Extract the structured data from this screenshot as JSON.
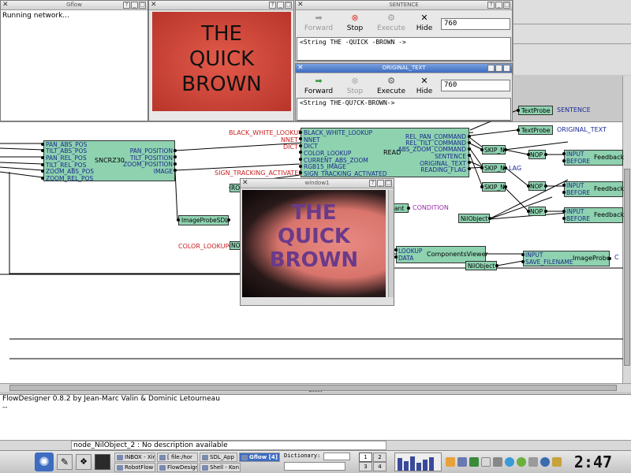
{
  "gflow_window": {
    "title": "Gflow",
    "log_text": "Running network..."
  },
  "camera_window": {
    "image_text": [
      "THE",
      "QUICK",
      "BROWN"
    ]
  },
  "sentence_window": {
    "title": "SENTENCE",
    "buttons": {
      "forward": "Forward",
      "stop": "Stop",
      "execute": "Execute",
      "hide": "Hide"
    },
    "value": "760",
    "output": "<String THE -QUICK -BROWN ->"
  },
  "original_text_window": {
    "title": "ORIGINAL_TEXT",
    "buttons": {
      "forward": "Forward",
      "stop": "Stop",
      "execute": "Execute",
      "hide": "Hide"
    },
    "value": "760",
    "output": "<String THE-QU?CK-BROWN->"
  },
  "window1": {
    "title": "window1",
    "image_text": [
      "THE",
      "QUICK",
      "BROWN"
    ]
  },
  "nodes": {
    "sncrz30": {
      "name": "SNCRZ30",
      "inputs": [
        "PAN_ABS_POS",
        "TILT_ABS_POS",
        "PAN_REL_POS",
        "TILT_REL_POS",
        "ZOOM_ABS_POS",
        "ZOOM_REL_POS"
      ],
      "outputs": [
        "PAN_POSITION",
        "TILT_POSITION",
        "ZOOM_POSITION",
        "IMAGE"
      ]
    },
    "read": {
      "name": "READ",
      "inputs": [
        "BLACK_WHITE_LOOKUP",
        "NNET",
        "DICT",
        "COLOR_LOOKUP",
        "CURRENT_ABS_ZOOM",
        "RGB15_IMAGE",
        "SIGN_TRACKING_ACTIVATED"
      ],
      "outputs": [
        "REL_PAN_COMMAND",
        "REL_TILT_COMMAND",
        "ABS_ZOOM_COMMAND",
        "SENTENCE",
        "ORIGINAL_TEXT",
        "READING_FLAG"
      ]
    },
    "image_probe_sdl": "ImageProbeSDL",
    "components_viewer": {
      "name": "ComponentsViewer",
      "inputs": [
        "LOOKUP",
        "DATA"
      ]
    },
    "image_probe": {
      "name": "ImageProbe",
      "inputs": [
        "INPUT",
        "SAVE_FILENAME"
      ]
    },
    "text_probe_1": "TextProbe",
    "text_probe_2": "TextProbe",
    "skip_nodes": [
      "SKIP_N",
      "SKIP_N",
      "SKIP_N"
    ],
    "nop_nodes": [
      "NOP",
      "NOP",
      "NOP"
    ],
    "feedback_nodes": [
      {
        "name": "Feedback",
        "inputs": [
          "INPUT",
          "BEFORE"
        ]
      },
      {
        "name": "Feedback",
        "inputs": [
          "INPUT",
          "BEFORE"
        ]
      },
      {
        "name": "Feedback",
        "inputs": [
          "INPUT",
          "BEFORE"
        ]
      }
    ],
    "nil_objects": [
      "NilObject",
      "NilObject"
    ],
    "small_node_ro": "RO",
    "small_node_no": "NO",
    "const_partial": "ant"
  },
  "canvas_labels": {
    "black_white_lookup": "BLACK_WHITE_LOOKUP",
    "nnet": "NNET",
    "dict": "DICT",
    "sign_tracking": "SIGN_TRACKING_ACTIVATED",
    "color_lookup": "COLOR_LOOKUP",
    "sentence": "SENTENCE",
    "original_text": "ORIGINAL_TEXT",
    "condition": "CONDITION",
    "flag": "LAG",
    "c_partial": "C"
  },
  "console": {
    "line1": "FlowDesigner 0.8.2 by Jean-Marc Valin & Dominic Letourneau",
    "line2": "--"
  },
  "status_bar": {
    "text": "node_NilObject_2 : No description available"
  },
  "taskbar": {
    "tasks": [
      {
        "label": "INBOX - Xim",
        "active": false
      },
      {
        "label": "[ file:/hor",
        "active": false
      },
      {
        "label": "SDL_App",
        "active": false
      },
      {
        "label": "Gflow [4]",
        "active": true
      },
      {
        "label": "RobotFlow",
        "active": false
      },
      {
        "label": "FlowDesign",
        "active": false
      },
      {
        "label": "Shell - Kon",
        "active": false
      }
    ],
    "dictionary_label": "Dictionary:",
    "pager": [
      "1",
      "2",
      "3",
      "4"
    ],
    "clock": "2:47",
    "icons": [
      "kde-menu-icon",
      "editor-icon",
      "terminal-icon",
      "monitor-icon"
    ]
  }
}
